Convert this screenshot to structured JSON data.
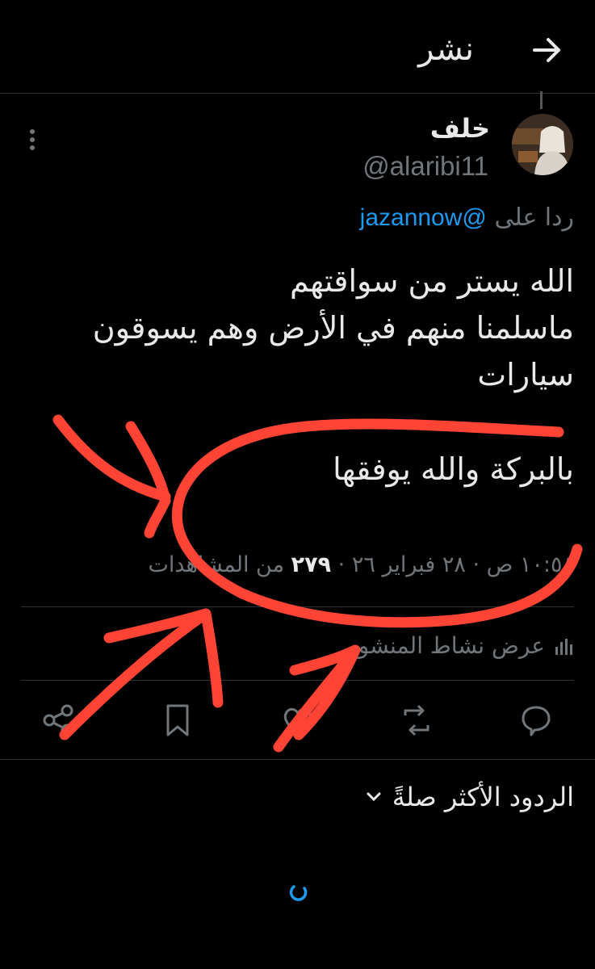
{
  "header": {
    "title": "نشر"
  },
  "tweet": {
    "name": "خلف",
    "handle": "@alaribi11",
    "reply_prefix": "ردا على",
    "reply_mention": "@jazannow",
    "lines": [
      "الله يستر من سواقتهم",
      "ماسلمنا منهم في الأرض وهم يسوقون سيارات",
      "بالبركة  والله يوفقها"
    ],
    "timestamp": "١٠:٥٨ ص · ٢٨ فبراير ٢٦ · ",
    "views_count": "٢٧٩",
    "views_label": " من المشاهدات"
  },
  "activity": {
    "label": "عرض نشاط المنشور"
  },
  "replies": {
    "sort_label": "الردود الأكثر صلةً"
  },
  "colors": {
    "accent": "#1d9bf0",
    "annotation": "#ff4436",
    "muted": "#71767b"
  },
  "icons": [
    "arrow-right-icon",
    "more-vertical-icon",
    "share-icon",
    "bookmark-icon",
    "like-icon",
    "retweet-icon",
    "reply-icon",
    "bar-chart-icon",
    "chevron-down-icon",
    "loading-spinner-icon"
  ]
}
